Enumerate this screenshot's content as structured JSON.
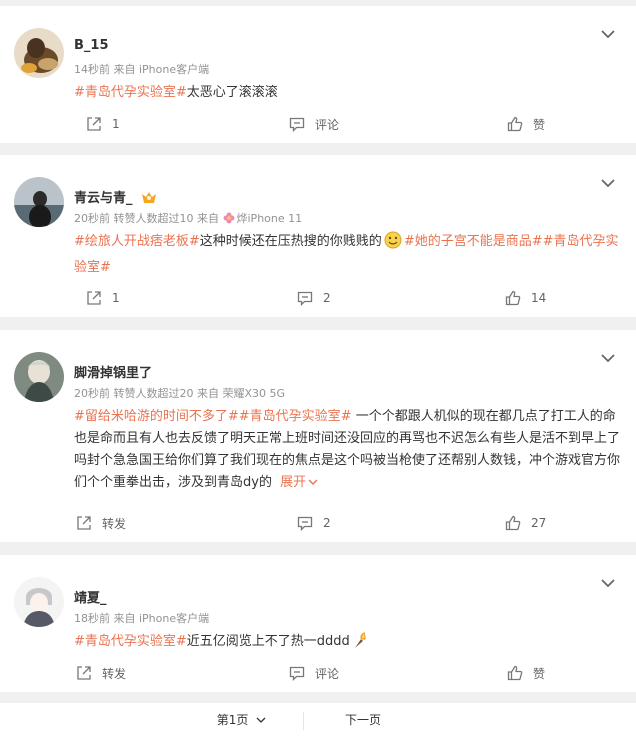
{
  "comments": [
    {
      "username": "B_15",
      "meta": "14秒前  来自 iPhone客户端",
      "segments": [
        {
          "t": "#青岛代孕实验室#",
          "tag": true
        },
        {
          "t": "太恶心了滚滚滚",
          "tag": false
        }
      ],
      "forward": "1",
      "comment": "评论",
      "like": "赞"
    },
    {
      "username": "青云与青_",
      "meta_prefix": "20秒前  转赞人数超过10  来自",
      "meta_suffix": "烨iPhone 11",
      "segments": [
        {
          "t": "#绘旅人开战痞老板#",
          "tag": true
        },
        {
          "t": "这种时候还在压热搜的你贱贱的",
          "tag": false
        },
        {
          "t": "#她的子宫不能是商品##青岛代孕实验室#",
          "tag": true
        }
      ],
      "forward": "1",
      "comment": "2",
      "like": "14"
    },
    {
      "username": "脚滑掉锅里了",
      "meta": "20秒前  转赞人数超过20  来自 荣耀X30 5G",
      "segments": [
        {
          "t": "#留给米哈游的时间不多了##青岛代孕实验室#",
          "tag": true
        },
        {
          "t": " 一个个都跟人机似的现在都几点了打工人的命也是命而且有人也去反馈了明天正常上班时间还没回应的再骂也不迟怎么有些人是活不到早上了吗封个急急国王给你们算了我们现在的焦点是这个吗被当枪使了还帮别人数钱，冲个游戏官方你们个个重拳出击，涉及到青岛dy的 ",
          "tag": false
        }
      ],
      "expand": "展开",
      "forward": "转发",
      "comment": "2",
      "like": "27"
    },
    {
      "username": "靖夏_",
      "meta": "18秒前  来自 iPhone客户端",
      "segments": [
        {
          "t": "#青岛代孕实验室#",
          "tag": true
        },
        {
          "t": "近五亿阅览上不了热一dddd",
          "tag": false
        }
      ],
      "forward": "转发",
      "comment": "评论",
      "like": "赞"
    }
  ],
  "pagination": {
    "current": "第1页",
    "next": "下一页"
  },
  "colors": {
    "tag": "#eb7350",
    "meta": "#939393",
    "background": "#f0f0f0"
  }
}
